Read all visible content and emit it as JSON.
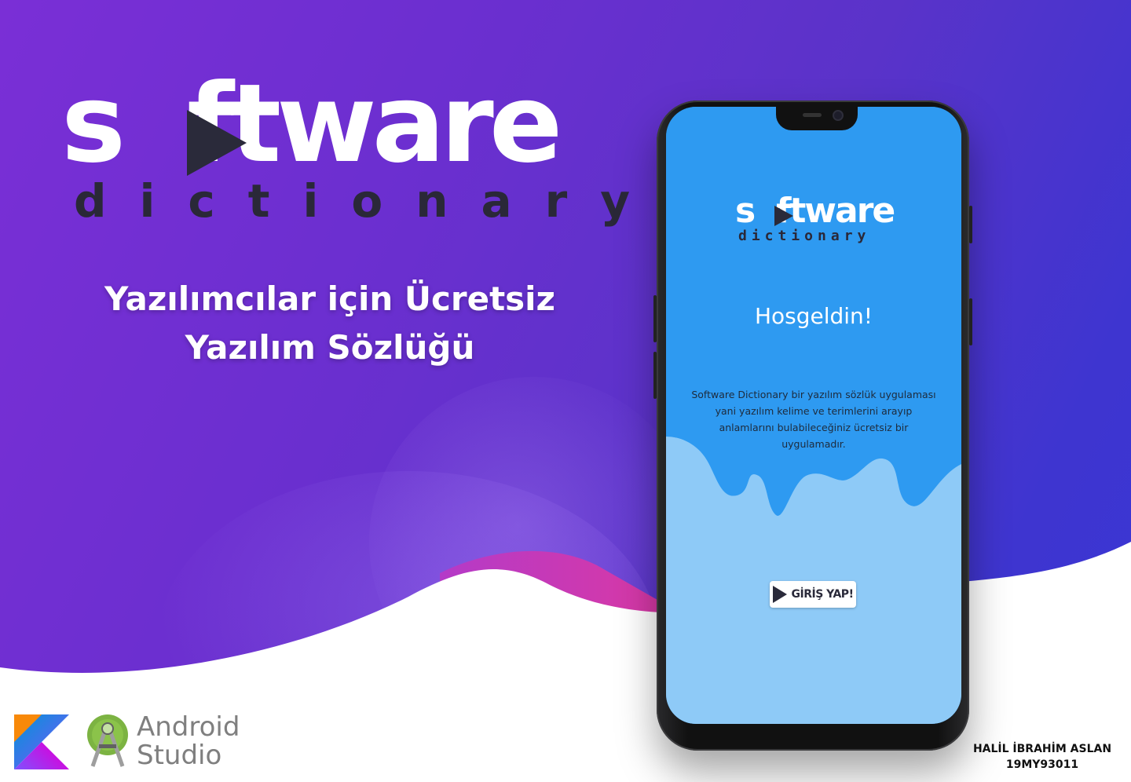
{
  "brand": {
    "logo_word_before": "s",
    "logo_word_after": "ftware",
    "logo_sub": "dictionary"
  },
  "tagline": {
    "line1": "Yazılımcılar için Ücretsiz",
    "line2": "Yazılım Sözlüğü"
  },
  "tools": {
    "android_studio_line1": "Android",
    "android_studio_line2": "Studio"
  },
  "author": {
    "name": "HALİL İBRAHİM ASLAN",
    "id": "19MY93011"
  },
  "app_screen": {
    "logo_word_before": "s",
    "logo_word_after": "ftware",
    "logo_sub": "dictionary",
    "welcome": "Hosgeldin!",
    "description": "Software Dictionary bir yazılım sözlük uygulaması yani yazılım kelime ve terimlerini arayıp anlamlarını bulabileceğiniz ücretsiz bir uygulamadır.",
    "login_button_label": "GİRİŞ YAP!"
  },
  "colors": {
    "background_purple": "#7a2fd6",
    "accent_pink": "#d63aa8",
    "screen_blue": "#2f9af0",
    "screen_light_blue": "#8ecaf7"
  },
  "icons": [
    "play-icon",
    "kotlin-icon",
    "android-studio-icon"
  ]
}
